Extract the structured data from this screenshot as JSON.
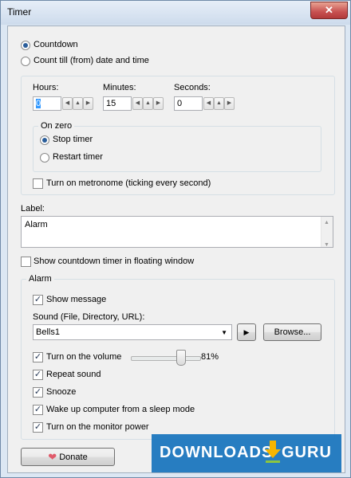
{
  "window": {
    "title": "Timer",
    "close_symbol": "✕"
  },
  "mode": {
    "countdown_label": "Countdown",
    "count_till_label": "Count till (from) date and time",
    "selected": "countdown"
  },
  "time": {
    "hours_label": "Hours:",
    "hours_value": "0",
    "minutes_label": "Minutes:",
    "minutes_value": "15",
    "seconds_label": "Seconds:",
    "seconds_value": "0"
  },
  "on_zero": {
    "title": "On zero",
    "stop_label": "Stop timer",
    "restart_label": "Restart timer",
    "selected": "stop"
  },
  "metronome": {
    "label": "Turn on metronome (ticking every second)",
    "checked": false
  },
  "label_section": {
    "title": "Label:",
    "value": "Alarm"
  },
  "floating": {
    "label": "Show countdown timer in floating window",
    "checked": false
  },
  "alarm": {
    "title": "Alarm",
    "show_message": {
      "label": "Show message",
      "checked": true
    },
    "sound_label": "Sound (File, Directory, URL):",
    "sound_value": "Bells1",
    "browse_label": "Browse...",
    "volume": {
      "label": "Turn on the volume",
      "checked": true,
      "percent_text": "81%",
      "level": 0.81
    },
    "repeat": {
      "label": "Repeat sound",
      "checked": true
    },
    "snooze": {
      "label": "Snooze",
      "checked": true
    },
    "wake": {
      "label": "Wake up computer from a sleep mode",
      "checked": true
    },
    "monitor": {
      "label": "Turn on the monitor power",
      "checked": true
    }
  },
  "footer": {
    "donate_label": "Donate"
  },
  "watermark": {
    "text_main": "DOWNLOADS",
    "text_suffix": "GURU",
    "colors": {
      "bg": "#1874bd",
      "arrow": "#f7b500"
    }
  }
}
